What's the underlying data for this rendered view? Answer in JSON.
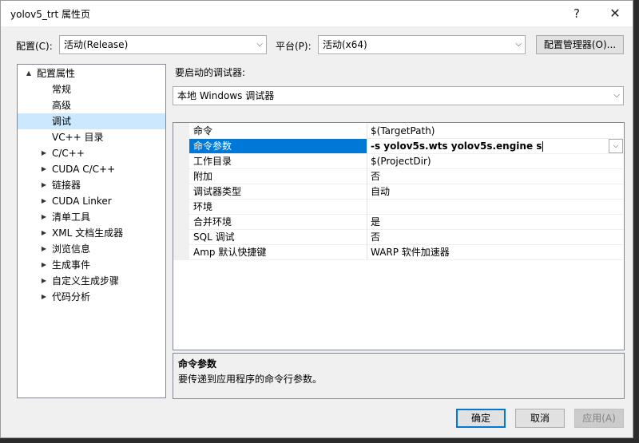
{
  "window": {
    "title": "yolov5_trt 属性页",
    "help_glyph": "?",
    "close_glyph": "✕"
  },
  "toolbar": {
    "config_label": "配置(C):",
    "config_value": "活动(Release)",
    "platform_label": "平台(P):",
    "platform_value": "活动(x64)",
    "config_manager_label": "配置管理器(O)..."
  },
  "tree": {
    "items": [
      {
        "label": "配置属性",
        "toggle": "▲"
      },
      {
        "label": "常规",
        "toggle": ""
      },
      {
        "label": "高级",
        "toggle": ""
      },
      {
        "label": "调试",
        "toggle": ""
      },
      {
        "label": "VC++ 目录",
        "toggle": ""
      },
      {
        "label": "C/C++",
        "toggle": "▶"
      },
      {
        "label": "CUDA C/C++",
        "toggle": "▶"
      },
      {
        "label": "链接器",
        "toggle": "▶"
      },
      {
        "label": "CUDA Linker",
        "toggle": "▶"
      },
      {
        "label": "清单工具",
        "toggle": "▶"
      },
      {
        "label": "XML 文档生成器",
        "toggle": "▶"
      },
      {
        "label": "浏览信息",
        "toggle": "▶"
      },
      {
        "label": "生成事件",
        "toggle": "▶"
      },
      {
        "label": "自定义生成步骤",
        "toggle": "▶"
      },
      {
        "label": "代码分析",
        "toggle": "▶"
      }
    ]
  },
  "debugger": {
    "label": "要启动的调试器:",
    "value": "本地 Windows 调试器"
  },
  "properties": {
    "rows": [
      {
        "name": "命令",
        "value": "$(TargetPath)"
      },
      {
        "name": "命令参数",
        "value": "-s yolov5s.wts yolov5s.engine s"
      },
      {
        "name": "工作目录",
        "value": "$(ProjectDir)"
      },
      {
        "name": "附加",
        "value": "否"
      },
      {
        "name": "调试器类型",
        "value": "自动"
      },
      {
        "name": "环境",
        "value": ""
      },
      {
        "name": "合并环境",
        "value": "是"
      },
      {
        "name": "SQL 调试",
        "value": "否"
      },
      {
        "name": "Amp 默认快捷键",
        "value": "WARP 软件加速器"
      }
    ]
  },
  "description": {
    "title": "命令参数",
    "text": "要传递到应用程序的命令行参数。"
  },
  "buttons": {
    "ok": "确定",
    "cancel": "取消",
    "apply": "应用(A)"
  },
  "icons": {
    "dropdown": "chevron-down-icon",
    "expand": "triangle-right-icon",
    "collapse": "triangle-down-icon"
  },
  "colors": {
    "accent": "#0078d7",
    "selection_light": "#cce8ff"
  }
}
